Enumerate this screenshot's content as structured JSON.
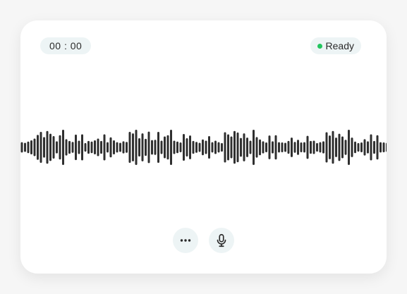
{
  "recorder": {
    "timer": "00 : 00",
    "status": {
      "label": "Ready",
      "dot_color": "#22c55e"
    },
    "waveform": {
      "color": "#2f2f2f",
      "levels": [
        0.18,
        0.14,
        0.22,
        0.3,
        0.42,
        0.66,
        0.86,
        0.52,
        0.92,
        0.74,
        0.58,
        0.24,
        0.64,
        1.0,
        0.38,
        0.26,
        0.2,
        0.68,
        0.28,
        0.7,
        0.12,
        0.26,
        0.22,
        0.3,
        0.42,
        0.26,
        0.7,
        0.18,
        0.5,
        0.3,
        0.18,
        0.14,
        0.24,
        0.2,
        0.86,
        0.76,
        1.0,
        0.44,
        0.76,
        0.4,
        0.88,
        0.32,
        0.34,
        0.86,
        0.28,
        0.56,
        0.64,
        1.0,
        0.28,
        0.22,
        0.16,
        0.72,
        0.44,
        0.62,
        0.26,
        0.2,
        0.14,
        0.36,
        0.28,
        0.58,
        0.18,
        0.28,
        0.18,
        0.12,
        0.84,
        0.7,
        0.56,
        0.92,
        0.82,
        0.46,
        0.76,
        0.48,
        0.28,
        1.0,
        0.52,
        0.36,
        0.24,
        0.16,
        0.62,
        0.24,
        0.64,
        0.18,
        0.16,
        0.14,
        0.26,
        0.48,
        0.2,
        0.34,
        0.16,
        0.18,
        0.6,
        0.26,
        0.28,
        0.12,
        0.18,
        0.24,
        0.84,
        0.62,
        0.92,
        0.48,
        0.74,
        0.56,
        0.34,
        1.0,
        0.48,
        0.22,
        0.12,
        0.16,
        0.38,
        0.24,
        0.7,
        0.26,
        0.64,
        0.18,
        0.16,
        0.14
      ]
    },
    "controls": {
      "more_icon": "more-icon",
      "mic_icon": "mic-icon"
    }
  }
}
